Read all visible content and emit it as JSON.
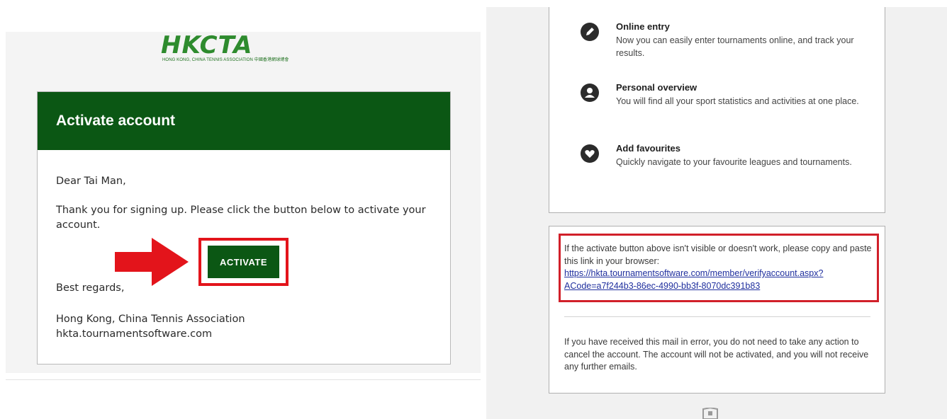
{
  "logo": {
    "mark": "HKCTA",
    "subtitle": "HONG KONG, CHINA TENNIS ASSOCIATION 中國香港網球總會"
  },
  "email": {
    "header_title": "Activate account",
    "greeting": "Dear Tai Man,",
    "body": "Thank you for signing up. Please click the button below to activate your account.",
    "button_label": "ACTIVATE",
    "signoff": "Best regards,",
    "org_name": "Hong Kong, China Tennis Association",
    "org_site": "hkta.tournamentsoftware.com"
  },
  "features": [
    {
      "icon": "pencil-icon",
      "title": "Online entry",
      "desc": "Now you can easily enter tournaments online, and track your results."
    },
    {
      "icon": "person-icon",
      "title": "Personal overview",
      "desc": "You will find all your sport statistics and activities at one place."
    },
    {
      "icon": "heart-icon",
      "title": "Add favourites",
      "desc": "Quickly navigate to your favourite leagues and tournaments."
    }
  ],
  "link_section": {
    "intro": "If the activate button above isn't visible or doesn't work, please copy and paste this link in your browser:",
    "link_line1": "https://hkta.tournamentsoftware.com/member/verifyaccount.aspx?",
    "link_line2": "ACode=a7f244b3-86ec-4990-bb3f-8070dc391b83",
    "error_note": "If you have received this mail in error, you do not need to take any action to cancel the account. The account will not be activated, and you will not receive any further emails."
  },
  "colors": {
    "brand_green": "#0b5714",
    "logo_green": "#2e8b2e",
    "highlight_red": "#e3141b",
    "link_blue": "#1f2f9e"
  }
}
